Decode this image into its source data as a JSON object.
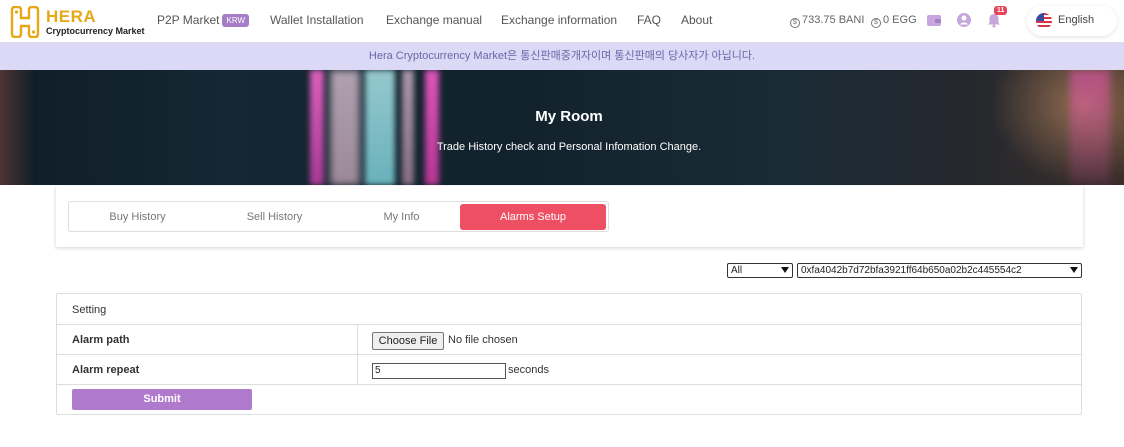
{
  "brand": {
    "title": "HERA",
    "subtitle": "Cryptocurrency Market"
  },
  "nav": {
    "p2p": "P2P Market",
    "krw_badge": "KRW",
    "wallet": "Wallet Installation",
    "exchange_manual": "Exchange manual",
    "exchange_info": "Exchange information",
    "faq": "FAQ",
    "about": "About"
  },
  "balances": {
    "bani": "733.75 BANI",
    "egg": "0 EGG"
  },
  "notifications": {
    "count": "11"
  },
  "language": {
    "label": "English"
  },
  "notice": {
    "text": "Hera Cryptocurrency Market은 통신판매중개자이며 통신판매의 당사자가 아닙니다."
  },
  "banner": {
    "title": "My Room",
    "subtitle": "Trade History check and Personal Infomation Change."
  },
  "tabs": [
    {
      "label": "Buy History"
    },
    {
      "label": "Sell History"
    },
    {
      "label": "My Info"
    },
    {
      "label": "Alarms Setup"
    }
  ],
  "filters": {
    "type": "All",
    "address": "0xfa4042b7d72bfa3921ff64b650a02b2c445554c2"
  },
  "settings": {
    "header": "Setting",
    "alarm_path_label": "Alarm path",
    "file_button": "Choose File",
    "file_status": "No file chosen",
    "alarm_repeat_label": "Alarm repeat",
    "repeat_value": "5",
    "repeat_unit": "seconds",
    "submit": "Submit"
  },
  "colors": {
    "accent": "#ef4f63",
    "brand": "#e6a817",
    "submit": "#b07acc",
    "notice_bg": "#dcd9f7"
  }
}
